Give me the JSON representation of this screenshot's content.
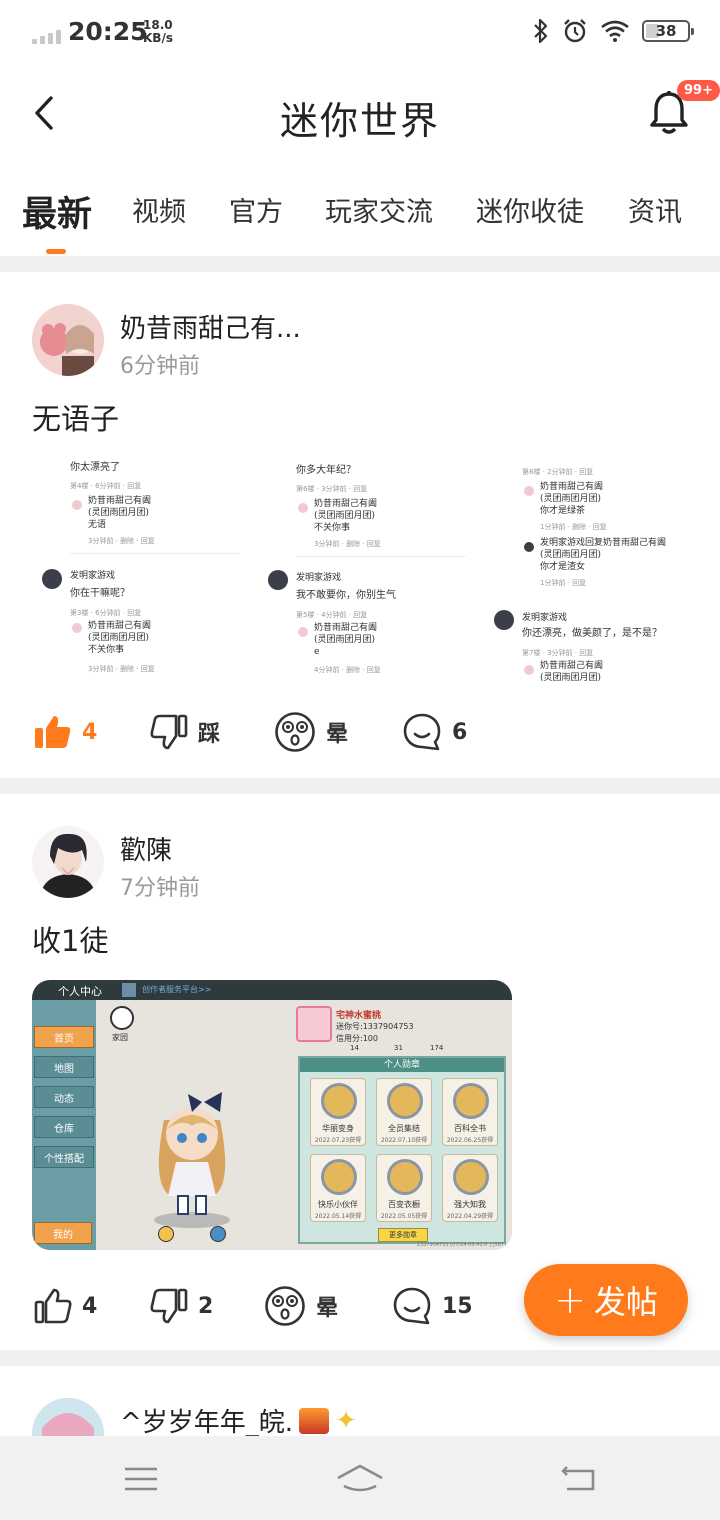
{
  "status_bar": {
    "time": "20:25",
    "speed_value": "18.0",
    "speed_unit": "KB/s",
    "battery": "38"
  },
  "header": {
    "title": "迷你世界",
    "notification_badge": "99+"
  },
  "tabs": [
    {
      "label": "最新",
      "active": true
    },
    {
      "label": "视频"
    },
    {
      "label": "官方"
    },
    {
      "label": "玩家交流"
    },
    {
      "label": "迷你收徒"
    },
    {
      "label": "资讯"
    }
  ],
  "posts": [
    {
      "author": "奶昔雨甜己有...",
      "time": "6分钟前",
      "text": "无语子",
      "likes": "4",
      "dislike_label": "踩",
      "dizzy_label": "晕",
      "comments": "6",
      "screenshot": {
        "col1": [
          "你太漂亮了",
          "第4楼 · 6分钟前 · 回复",
          "奶昔雨甜己有阖",
          "(灵团雨团月团)",
          "无语",
          "3分钟前 · 删除 · 回复",
          "发明家游戏",
          "你在干嘛呢？",
          "第3楼 · 6分钟前 · 回复",
          "奶昔雨甜己有阖",
          "(灵团雨团月团)",
          "不关你事",
          "3分钟前 · 删除 · 回复"
        ],
        "col2": [
          "你多大年纪？",
          "第6楼 · 3分钟前 · 回复",
          "奶昔雨甜己有阖",
          "(灵团雨团月团)",
          "不关你事",
          "3分钟前 · 删除 · 回复",
          "发明家游戏",
          "我不敢要你，你别生气",
          "第5楼 · 4分钟前 · 回复",
          "奶昔雨甜己有阖",
          "(灵团雨团月团)",
          "e",
          "4分钟前 · 删除 · 回复"
        ],
        "col3": [
          "第8楼 · 2分钟前 · 回复",
          "奶昔雨甜己有阖",
          "(灵团雨团月团)",
          "你才是绿茶",
          "1分钟前 · 删除 · 回复",
          "发明家游戏回复奶昔雨甜己有阖",
          "(灵团雨团月团)",
          "你才是渣女",
          "1分钟前 · 回复",
          "发明家游戏",
          "你还漂亮，做美颜了，是不是？",
          "第7楼 · 3分钟前 · 回复",
          "奶昔雨甜己有阖",
          "(灵团雨团月团)"
        ]
      }
    },
    {
      "author": "歡陳",
      "time": "7分钟前",
      "text": "收1徒",
      "likes": "4",
      "dislikes": "2",
      "dizzy_label": "晕",
      "comments": "15",
      "game": {
        "title": "个人中心",
        "subtitle": "创作者服务平台>>",
        "home_label": "家园",
        "player_name": "宅神水蜜桃",
        "mini_id": "迷你号:1337904753",
        "credit": "信用分:100",
        "stats": [
          "14",
          "31",
          "174"
        ],
        "menu": [
          "首页",
          "地图",
          "动态",
          "仓库",
          "个性搭配"
        ],
        "me_button": "我的",
        "panel_title": "个人勋章",
        "medals": [
          {
            "name": "华丽变身",
            "date": "2022.07.23获得"
          },
          {
            "name": "全员集结",
            "date": "2022.07.10获得"
          },
          {
            "name": "百科全书",
            "date": "2022.06.25获得"
          },
          {
            "name": "快乐小伙伴",
            "date": "2022.05.14获得"
          },
          {
            "name": "百变衣橱",
            "date": "2022.05.05获得"
          },
          {
            "name": "强大知我",
            "date": "2022.04.29获得"
          }
        ],
        "more_button": "更多勋章",
        "footer": "1337904753 [07/24 08:41:0 ] [587]"
      }
    },
    {
      "author": "^岁岁年年_皖."
    }
  ],
  "fab": {
    "plus": "+",
    "label": "发帖"
  },
  "colors": {
    "accent": "#ff7a1a",
    "badge": "#ff5a48"
  }
}
